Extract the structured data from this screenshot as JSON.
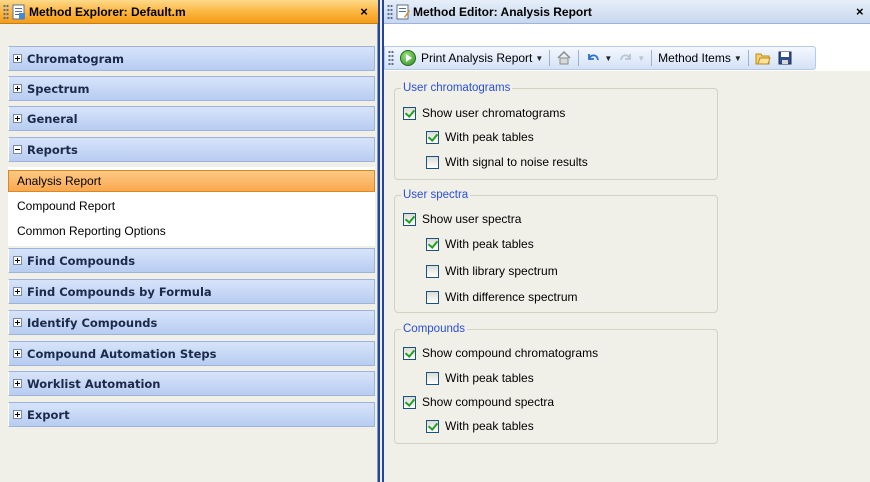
{
  "left_panel": {
    "title": "Method Explorer: Default.m",
    "close_glyph": "×",
    "groups": [
      {
        "label": "Chromatogram",
        "state": "collapsed"
      },
      {
        "label": "Spectrum",
        "state": "collapsed"
      },
      {
        "label": "General",
        "state": "collapsed"
      },
      {
        "label": "Reports",
        "state": "expanded"
      },
      {
        "label": "Find Compounds",
        "state": "collapsed"
      },
      {
        "label": "Find Compounds by Formula",
        "state": "collapsed"
      },
      {
        "label": "Identify Compounds",
        "state": "collapsed"
      },
      {
        "label": "Compound Automation Steps",
        "state": "collapsed"
      },
      {
        "label": "Worklist Automation",
        "state": "collapsed"
      },
      {
        "label": "Export",
        "state": "collapsed"
      }
    ],
    "reports_items": [
      {
        "label": "Analysis Report",
        "selected": true
      },
      {
        "label": "Compound Report",
        "selected": false
      },
      {
        "label": "Common Reporting Options",
        "selected": false
      }
    ]
  },
  "right_panel": {
    "title": "Method Editor: Analysis Report",
    "close_glyph": "×",
    "toolbar": {
      "print_label": "Print Analysis Report",
      "method_items_label": "Method Items",
      "icons": [
        "play-icon",
        "home-icon",
        "undo-icon",
        "redo-icon",
        "open-icon",
        "save-icon"
      ]
    },
    "sections": [
      {
        "legend": "User chromatograms",
        "options": [
          {
            "label": "Show user chromatograms",
            "checked": true,
            "indent": 0
          },
          {
            "label": "With peak tables",
            "checked": true,
            "indent": 1
          },
          {
            "label": "With signal to noise results",
            "checked": false,
            "indent": 1
          }
        ]
      },
      {
        "legend": "User spectra",
        "options": [
          {
            "label": "Show user spectra",
            "checked": true,
            "indent": 0
          },
          {
            "label": "With peak tables",
            "checked": true,
            "indent": 1
          },
          {
            "label": "With library spectrum",
            "checked": false,
            "indent": 1
          },
          {
            "label": "With difference spectrum",
            "checked": false,
            "indent": 1
          }
        ]
      },
      {
        "legend": "Compounds",
        "options": [
          {
            "label": "Show compound chromatograms",
            "checked": true,
            "indent": 0
          },
          {
            "label": "With peak tables",
            "checked": false,
            "indent": 1
          },
          {
            "label": "Show compound spectra",
            "checked": true,
            "indent": 0
          },
          {
            "label": "With peak tables",
            "checked": true,
            "indent": 1
          }
        ]
      }
    ]
  },
  "colors": {
    "left_title_bar": "#f9a94f",
    "selected_item": "#fdc985",
    "group_header": "#c8d8f5",
    "legend_text": "#2a4fd7",
    "splitter": "#24459e"
  }
}
